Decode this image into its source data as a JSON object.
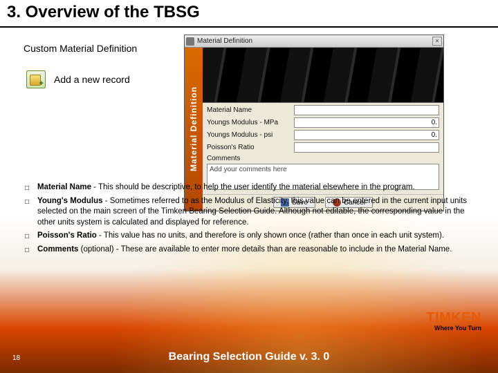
{
  "header": {
    "title": "3. Overview of the TBSG"
  },
  "subtitle": "Custom Material Definition",
  "add_record": {
    "label": "Add a new record"
  },
  "dialog": {
    "title": "Material Definition",
    "sidebar_label": "Material Definition",
    "fields": {
      "material_name": {
        "label": "Material Name",
        "value": ""
      },
      "ym_mpa": {
        "label": "Youngs Modulus - MPa",
        "value": "0."
      },
      "ym_psi": {
        "label": "Youngs Modulus - psi",
        "value": "0."
      },
      "poisson": {
        "label": "Poisson's Ratio",
        "value": ""
      },
      "comments": {
        "label": "Comments",
        "value": "Add your comments here"
      }
    },
    "buttons": {
      "save": "Save",
      "cancel": "Cancel"
    }
  },
  "bullets": [
    {
      "term": "Material Name",
      "rest": " - This should be descriptive, to help the user identify the material elsewhere in the program."
    },
    {
      "term": "Young's Modulus",
      "rest": " - Sometimes referred to as the Modulus of Elasticity, this value can be entered in the current input units selected on the main screen of the Timken Bearing Selection Guide. Although not editable, the corresponding value in the other units system is calculated and displayed for reference."
    },
    {
      "term": "Poisson's Ratio",
      "rest": " - This value has no units, and therefore is only shown once (rather than once in each unit system)."
    },
    {
      "term": "Comments",
      "rest": " (optional) - These are available to enter more details than are reasonable to include in the Material Name."
    }
  ],
  "logo": {
    "brand": "TIMKEN",
    "tagline": "Where You Turn"
  },
  "footer": {
    "page": "18",
    "title": "Bearing Selection Guide v. 3. 0"
  }
}
